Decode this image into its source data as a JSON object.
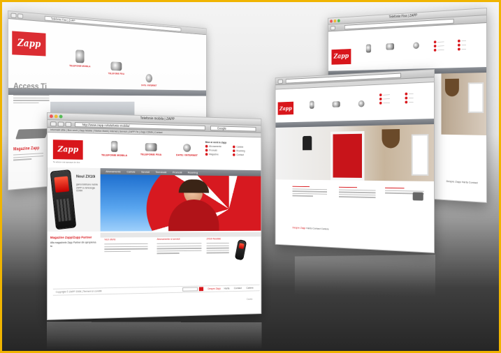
{
  "brand": {
    "logo": "Zapp",
    "tagline": "Te aduce mai aproape de tine"
  },
  "colors": {
    "accent": "#d8161b",
    "frame": "#f0b400",
    "nav_gray": "#7e8288"
  },
  "front": {
    "window_title": "Telefonie mobila | ZAPP",
    "url": "http://www.zapp.ro/telefonie-mobila/",
    "search_placeholder": "Google",
    "bookmarks": "Informatii Utile | Bun venit | Zapp Mobile | Telefon Mobil | Internet | Servicii | ZAPP Fix | Zapp CDMA | Contact",
    "products": [
      {
        "label": "TELEFONIE MOBILA",
        "icon": "mobile-phone-icon"
      },
      {
        "label": "TELEFONIE FIXA",
        "icon": "desk-phone-icon"
      },
      {
        "label": "DATE / INTERNET",
        "icon": "globe-icon"
      }
    ],
    "services_title": "Bine ai venit in Zapp",
    "services": [
      "Abonamente",
      "Cartele",
      "Promotii",
      "Roaming",
      "Magazine",
      "Contact"
    ],
    "nav": [
      "Abonamente",
      "Cartele",
      "Servicii",
      "Terminale",
      "Promotii",
      "Roaming"
    ],
    "promo_title": "Noul ZX10i",
    "promo_text": "gama telefoane mobile ZAPP cu tehnologie CDMA",
    "promo_heading": "Magazine Zapp/Zapp Partner",
    "promo_body": "Afla magazinele Zapp Partner din apropierea ta",
    "col_heads": [
      "Vezi oferte",
      "Abonamente si servicii",
      "ZX10i Noutate"
    ],
    "footer_left": "Copyright © ZAPP 2006 | Termeni si conditii",
    "footer_links": [
      "Despre Zapp",
      "Harta",
      "Contact",
      "Cariere"
    ],
    "footer_button": "Cauta"
  },
  "back_windows": {
    "window_title": "Telefonie Fixa | ZAPP",
    "left_window_title": "Telefonie Fixa | ZAPP",
    "heading_partial": "Access Ti",
    "sub_partial": "Magazine Zapp",
    "products": [
      "TELEFONIE MOBILA",
      "TELEFONIE FIXA",
      "DATE / INTERNET"
    ],
    "footer_links": [
      "Despre Zapp",
      "Harta",
      "Contact",
      "Cariere"
    ]
  }
}
